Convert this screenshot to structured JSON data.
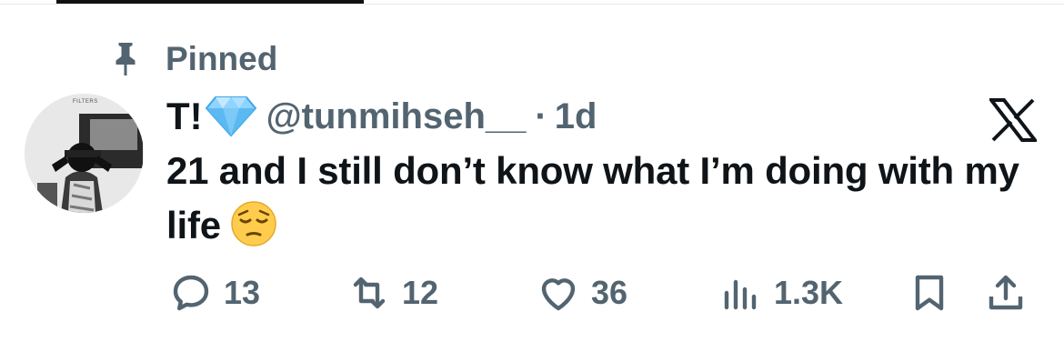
{
  "pinned": {
    "label": "Pinned"
  },
  "tweet": {
    "author_name": "T!",
    "handle": "@tunmihseh__",
    "separator": "·",
    "time": "1d",
    "text": "21 and I still don’t know what I’m doing with my life",
    "avatar_caption": "FILTERS",
    "emojis": {
      "name_badge": "gem-stone",
      "text_end": "pensive-face"
    }
  },
  "actions": {
    "replies": "13",
    "reposts": "12",
    "likes": "36",
    "views": "1.3K"
  },
  "colors": {
    "text": "#0f1419",
    "secondary": "#536471",
    "gem": "#6ec1f5",
    "emoji": "#ffcc4d"
  }
}
